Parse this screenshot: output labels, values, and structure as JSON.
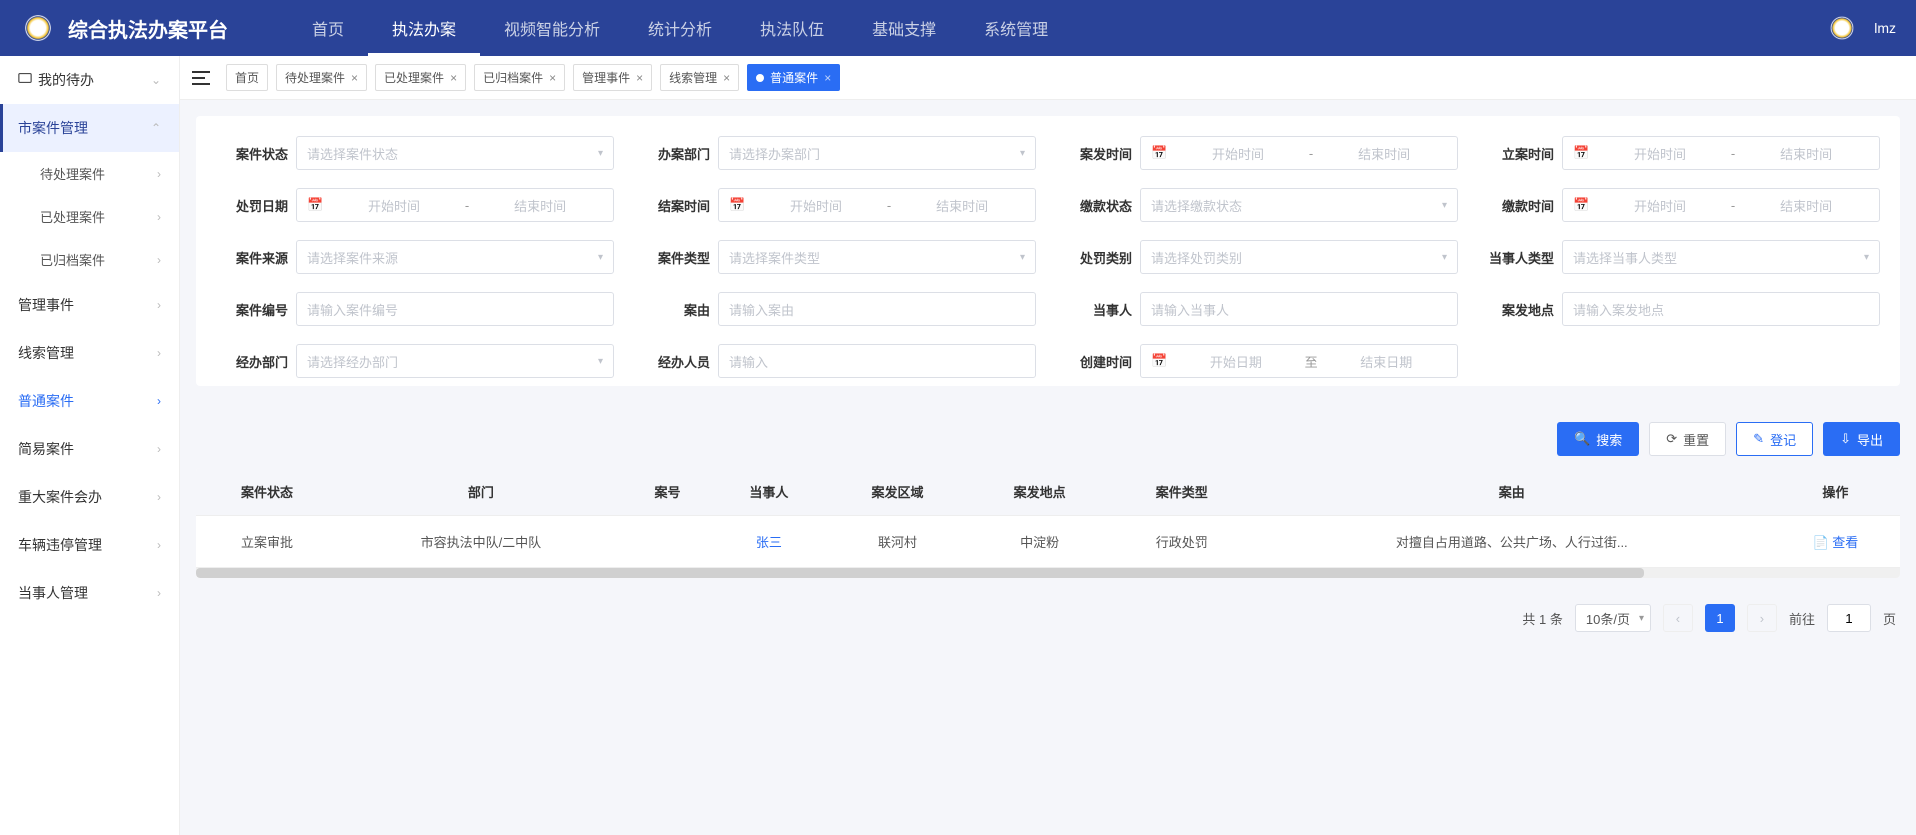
{
  "header": {
    "title": "综合执法办案平台",
    "nav": [
      "首页",
      "执法办案",
      "视频智能分析",
      "统计分析",
      "执法队伍",
      "基础支撑",
      "系统管理"
    ],
    "username": "lmz"
  },
  "sidebar": {
    "group1": {
      "label": "我的待办"
    },
    "group2": {
      "label": "市案件管理",
      "items": [
        "待处理案件",
        "已处理案件",
        "已归档案件"
      ]
    },
    "menus": [
      "管理事件",
      "线索管理",
      "普通案件",
      "简易案件",
      "重大案件会办",
      "车辆违停管理",
      "当事人管理"
    ],
    "active_menu_index": 2
  },
  "tabs": {
    "items": [
      "首页",
      "待处理案件",
      "已处理案件",
      "已归档案件",
      "管理事件",
      "线索管理",
      "普通案件"
    ],
    "active_index": 6
  },
  "form": {
    "labels": {
      "case_status": "案件状态",
      "dept": "办案部门",
      "occur_time": "案发时间",
      "file_time": "立案时间",
      "punish_date": "处罚日期",
      "close_time": "结案时间",
      "pay_status": "缴款状态",
      "pay_time": "缴款时间",
      "case_source": "案件来源",
      "case_type": "案件类型",
      "punish_kind": "处罚类别",
      "party_type": "当事人类型",
      "case_no": "案件编号",
      "cause": "案由",
      "party": "当事人",
      "occur_place": "案发地点",
      "handle_dept": "经办部门",
      "handler": "经办人员",
      "create_time": "创建时间"
    },
    "placeholders": {
      "case_status": "请选择案件状态",
      "dept": "请选择办案部门",
      "start_time": "开始时间",
      "end_time": "结束时间",
      "pay_status": "请选择缴款状态",
      "case_source": "请选择案件来源",
      "case_type": "请选择案件类型",
      "punish_kind": "请选择处罚类别",
      "party_type": "请选择当事人类型",
      "case_no": "请输入案件编号",
      "cause": "请输入案由",
      "party": "请输入当事人",
      "occur_place": "请输入案发地点",
      "handle_dept": "请选择经办部门",
      "handler": "请输入",
      "start_date": "开始日期",
      "end_date": "结束日期",
      "to": "至"
    }
  },
  "actions": {
    "search": "搜索",
    "reset": "重置",
    "register": "登记",
    "export": "导出"
  },
  "table": {
    "headers": [
      "案件状态",
      "部门",
      "案号",
      "当事人",
      "案发区域",
      "案发地点",
      "案件类型",
      "案由",
      "操作"
    ],
    "row": {
      "status": "立案审批",
      "dept": "市容执法中队/二中队",
      "case_no": "",
      "party": "张三",
      "area": "联河村",
      "place": "中淀粉",
      "type": "行政处罚",
      "cause": "对擅自占用道路、公共广场、人行过街...",
      "op": "查看"
    }
  },
  "pager": {
    "total_text": "共 1 条",
    "page_size": "10条/页",
    "current": "1",
    "goto_prefix": "前往",
    "goto_value": "1",
    "goto_suffix": "页"
  }
}
